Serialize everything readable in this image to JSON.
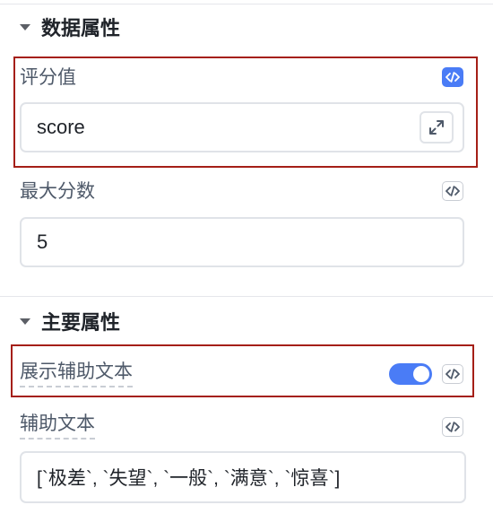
{
  "data_section": {
    "title": "数据属性",
    "rating_value": {
      "label": "评分值",
      "value": "score"
    },
    "max_score": {
      "label": "最大分数",
      "value": "5"
    }
  },
  "main_section": {
    "title": "主要属性",
    "show_helper_text": {
      "label": "展示辅助文本",
      "enabled": true
    },
    "helper_text": {
      "label": "辅助文本",
      "value": "[`极差`, `失望`, `一般`, `满意`, `惊喜`]"
    }
  },
  "colors": {
    "accent": "#4a7cf6",
    "highlight_border": "#a51f17"
  },
  "icons": {
    "section_toggle": "caret-down-icon",
    "code_toggle": "code-icon",
    "expand": "expand-icon"
  }
}
